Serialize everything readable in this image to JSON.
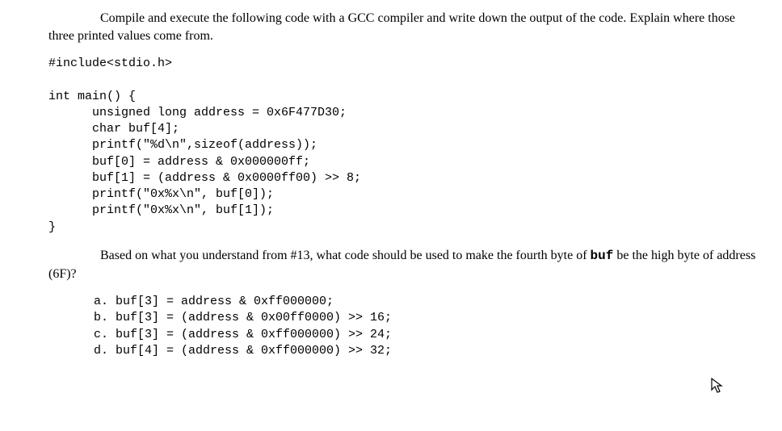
{
  "intro": {
    "text": "Compile and execute the following code with a GCC compiler and write down the output of the code. Explain where those three printed values come from."
  },
  "code": {
    "text": "#include<stdio.h>\n\nint main() {\n      unsigned long address = 0x6F477D30;\n      char buf[4];\n      printf(\"%d\\n\",sizeof(address));\n      buf[0] = address & 0x000000ff;\n      buf[1] = (address & 0x0000ff00) >> 8;\n      printf(\"0x%x\\n\", buf[0]);\n      printf(\"0x%x\\n\", buf[1]);\n}"
  },
  "question": {
    "lead": "Based on what you understand from #13, what code should be used to make the fourth byte of ",
    "buf_word": "buf",
    "tail": " be the high byte of address (6F)?"
  },
  "options": {
    "text": "a. buf[3] = address & 0xff000000;\nb. buf[3] = (address & 0x00ff0000) >> 16;\nc. buf[3] = (address & 0xff000000) >> 24;\nd. buf[4] = (address & 0xff000000) >> 32;"
  }
}
